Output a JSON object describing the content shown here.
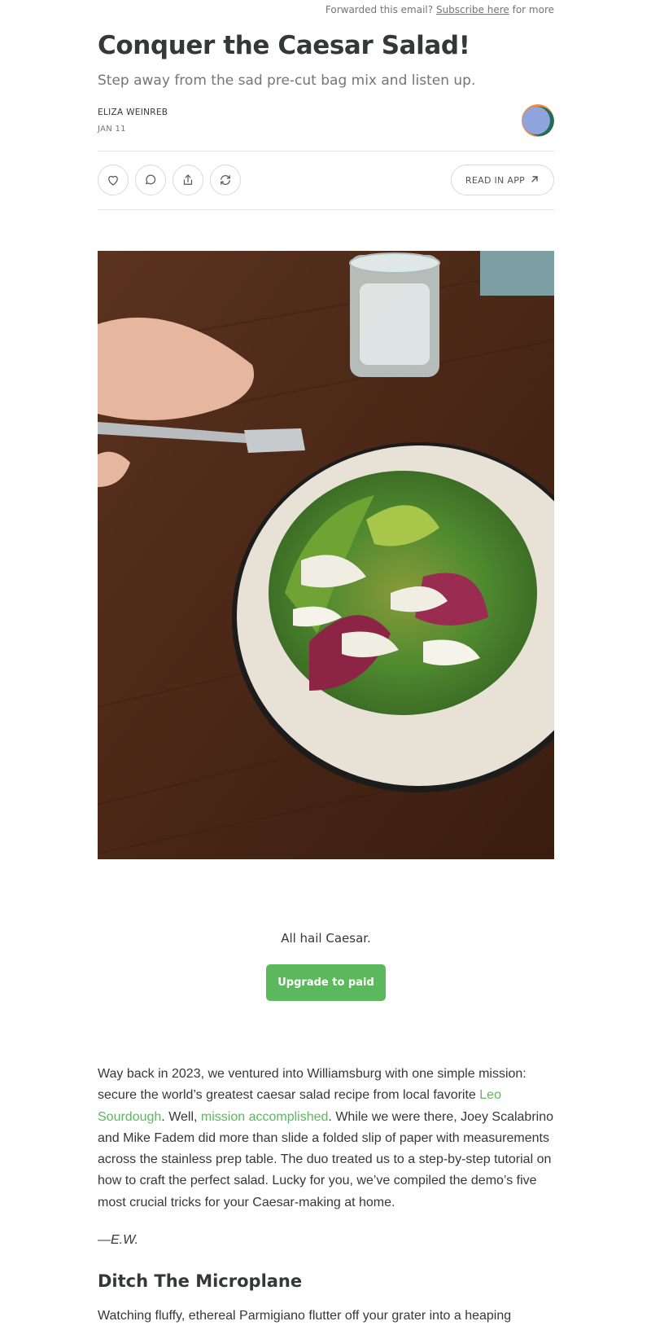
{
  "forward_bar": {
    "prefix": "Forwarded this email?",
    "link": "Subscribe here",
    "suffix": "for more"
  },
  "post": {
    "title": "Conquer the Caesar Salad!",
    "subtitle": "Step away from the sad pre-cut bag mix and listen up.",
    "author": "ELIZA WEINREB",
    "date": "JAN 11"
  },
  "actions": {
    "like_icon": "heart-icon",
    "comment_icon": "comment-icon",
    "share_icon": "share-icon",
    "restack_icon": "restack-icon",
    "read_in_app": "READ IN APP"
  },
  "image": {
    "caption": "All hail Caesar."
  },
  "cta": {
    "upgrade_label": "Upgrade to paid"
  },
  "article": {
    "p1_part1": "Way back in 2023, we ventured into Williamsburg with one simple mission: secure the world’s greatest caesar salad recipe from local favorite ",
    "link1": "Leo Sourdough",
    "p1_part2": ". Well, ",
    "link2": "mission accomplished",
    "p1_part3": ". While we were there, Joey Scalabrino and Mike Fadem did more than slide a folded slip of paper with measurements across the stainless prep table. The duo treated us to a step-by-step tutorial on how to craft the perfect salad. Lucky for you, we’ve compiled the demo’s five most crucial tricks for your Caesar-making at home.",
    "signoff": "—E.W.",
    "section_heading": "Ditch The Microplane",
    "p2": "Watching fluffy, ethereal Parmigiano flutter off your grater into a heaping"
  },
  "colors": {
    "accent_green": "#5cb85c",
    "text": "#363737",
    "muted": "#757575"
  }
}
